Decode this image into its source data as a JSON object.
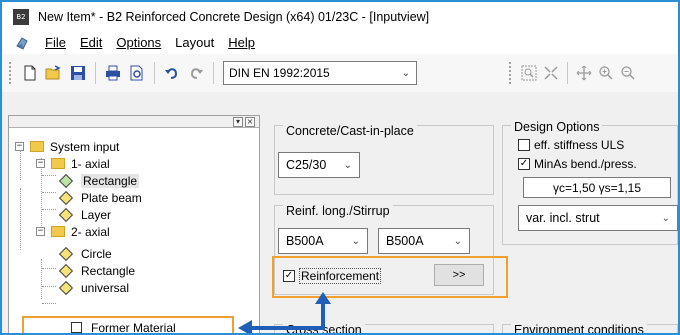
{
  "window": {
    "app_icon_text": "B2",
    "title": "New Item* - B2 Reinforced Concrete Design (x64) 01/23C - [Inputview]"
  },
  "menubar": {
    "items": [
      {
        "label": "File"
      },
      {
        "label": "Edit"
      },
      {
        "label": "Options"
      },
      {
        "label": "Layout"
      },
      {
        "label": "Help"
      }
    ]
  },
  "toolbar": {
    "norm_select": "DIN EN 1992:2015",
    "icons": [
      "new-file-icon",
      "open-folder-icon",
      "save-icon",
      "print-icon",
      "print-preview-icon",
      "undo-icon",
      "redo-icon"
    ],
    "right_icons": [
      "zoom-window-icon",
      "zoom-extents-icon",
      "pan-icon",
      "zoom-in-icon",
      "zoom-out-icon"
    ]
  },
  "tree": {
    "rows": [
      {
        "label": "System input"
      },
      {
        "label": "1- axial"
      },
      {
        "label": "Rectangle"
      },
      {
        "label": "Plate beam"
      },
      {
        "label": "Layer"
      },
      {
        "label": "2- axial"
      },
      {
        "label": "Circle"
      },
      {
        "label": "Rectangle"
      },
      {
        "label": "universal"
      },
      {
        "label": "Former Material"
      }
    ]
  },
  "concrete": {
    "group_title": "Concrete/Cast-in-place",
    "grade": "C25/30"
  },
  "reinf": {
    "group_title": "Reinf. long./Stirrup",
    "long": "B500A",
    "stirrup": "B500A",
    "checkbox_label": "Reinforcement",
    "checked": true,
    "more_button": ">>"
  },
  "design_options": {
    "group_title": "Design  Options",
    "eff_stiffness_label": "eff. stiffness ULS",
    "eff_stiffness_checked": false,
    "minas_label": "MinAs bend./press.",
    "minas_checked": true,
    "gamma": "γc=1,50  γs=1,15",
    "strut_select": "var. incl. strut"
  },
  "cross_section": {
    "group_title": "Cross section"
  },
  "environment": {
    "group_title": "Environment conditions"
  },
  "colors": {
    "frame_border": "#2a8fd6",
    "highlight": "#f0a030",
    "arrow": "#1f5fb8"
  }
}
